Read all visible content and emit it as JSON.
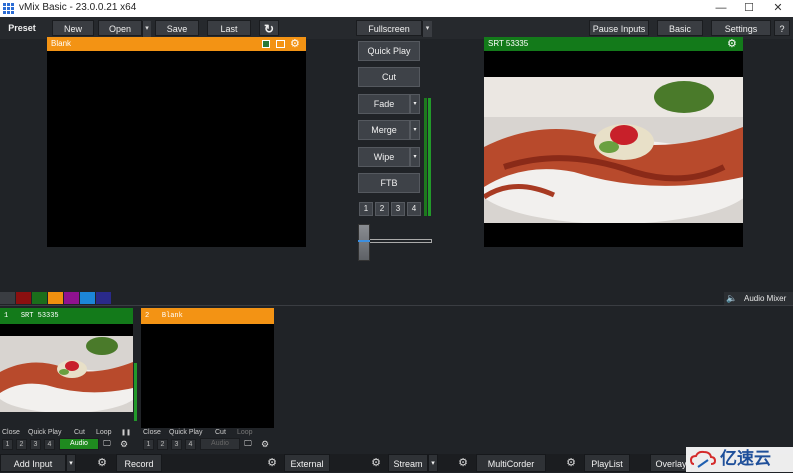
{
  "window": {
    "title": "vMix Basic - 23.0.0.21 x64",
    "minimize": "—",
    "maximize": "☐",
    "close": "✕"
  },
  "topbar": {
    "preset": "Preset",
    "new": "New",
    "open": "Open",
    "save": "Save",
    "last": "Last",
    "refresh_icon": "↻",
    "fullscreen": "Fullscreen",
    "pause_inputs": "Pause Inputs",
    "basic": "Basic",
    "settings": "Settings",
    "help": "?",
    "dropdown": "▾"
  },
  "preview": {
    "title": "Blank",
    "header_color": "#f39314"
  },
  "output": {
    "title": "SRT  53335",
    "header_color": "#137a1a"
  },
  "transitions": {
    "quick_play": "Quick Play",
    "cut": "Cut",
    "fade": "Fade",
    "merge": "Merge",
    "wipe": "Wipe",
    "ftb": "FTB",
    "numbers": [
      "1",
      "2",
      "3",
      "4"
    ]
  },
  "colors": [
    "#8b1010",
    "#1b6e1b",
    "#f0900f",
    "#8f128f",
    "#1c86d8",
    "#2a2a8a"
  ],
  "audio_mixer": {
    "icon": "speaker-icon",
    "label": "Audio Mixer"
  },
  "inputs": [
    {
      "number": "1",
      "name": "SRT  53335",
      "header_color": "#137a1a",
      "controls": [
        "Close",
        "Quick Play",
        "Cut",
        "Loop"
      ],
      "pause": "❚❚",
      "audio": "Audio",
      "overlays": [
        "1",
        "2",
        "3",
        "4"
      ]
    },
    {
      "number": "2",
      "name": "Blank",
      "header_color": "#f39314",
      "controls": [
        "Close",
        "Quick Play",
        "Cut",
        "Loop"
      ],
      "audio": "Audio",
      "overlays": [
        "1",
        "2",
        "3",
        "4"
      ]
    }
  ],
  "bottombar": {
    "add_input": "Add Input",
    "record": "Record",
    "external": "External",
    "stream": "Stream",
    "multicorder": "MultiCorder",
    "playlist": "PlayList",
    "overlay": "Overlay"
  },
  "watermark": {
    "text": "亿速云"
  }
}
